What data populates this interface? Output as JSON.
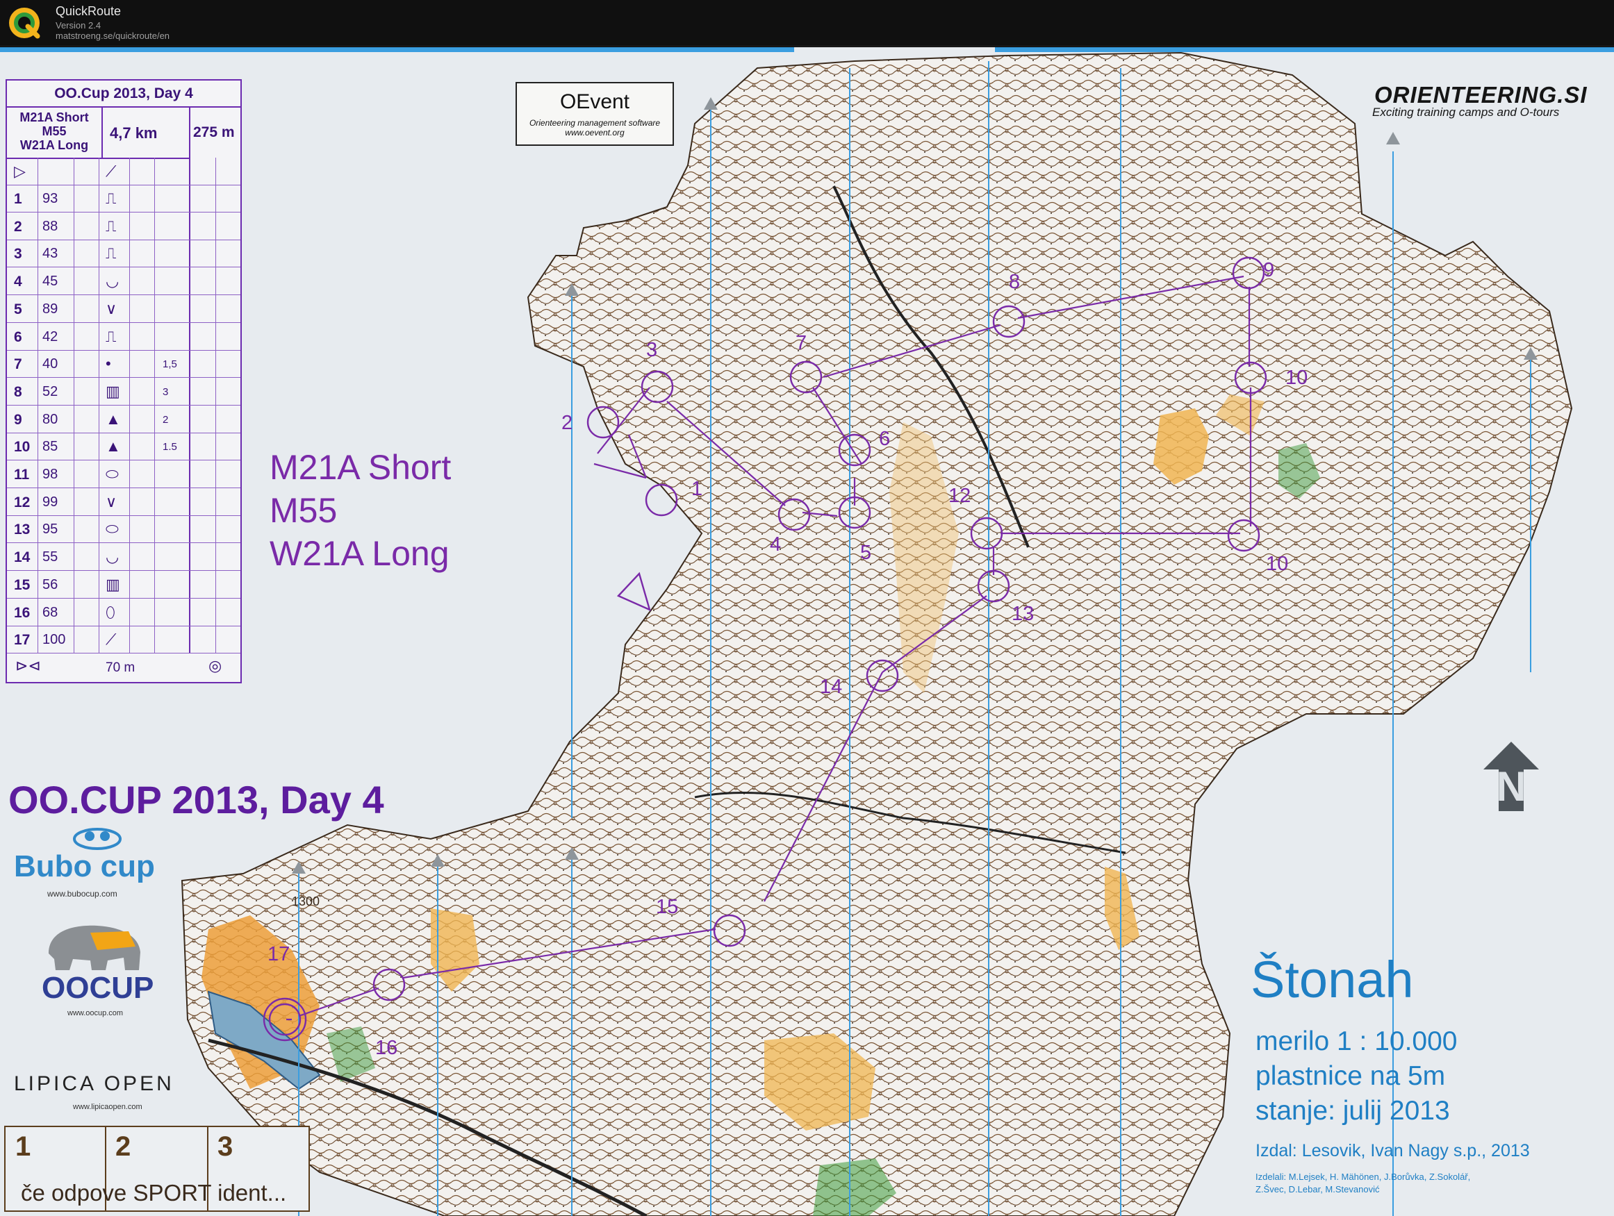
{
  "app": {
    "name": "QuickRoute",
    "version": "Version 2.4",
    "url": "matstroeng.se/quickroute/en",
    "logo_icon": "quickroute-q-icon"
  },
  "description_sheet": {
    "header": "OO.Cup 2013, Day 4",
    "class_line_1": "M21A Short",
    "class_line_2": "M55",
    "class_line_3": "W21A Long",
    "length": "4,7 km",
    "climb": "275 m",
    "rows": [
      {
        "num": "1",
        "code": "93"
      },
      {
        "num": "2",
        "code": "88"
      },
      {
        "num": "3",
        "code": "43"
      },
      {
        "num": "4",
        "code": "45"
      },
      {
        "num": "5",
        "code": "89"
      },
      {
        "num": "6",
        "code": "42"
      },
      {
        "num": "7",
        "code": "40",
        "dim": "1,5"
      },
      {
        "num": "8",
        "code": "52",
        "dim": "3"
      },
      {
        "num": "9",
        "code": "80",
        "dim": "2"
      },
      {
        "num": "10",
        "code": "85",
        "dim": "1.5"
      },
      {
        "num": "11",
        "code": "98"
      },
      {
        "num": "12",
        "code": "99"
      },
      {
        "num": "13",
        "code": "95"
      },
      {
        "num": "14",
        "code": "55"
      },
      {
        "num": "15",
        "code": "56"
      },
      {
        "num": "16",
        "code": "68"
      },
      {
        "num": "17",
        "code": "100"
      }
    ],
    "finish_distance": "70 m"
  },
  "classes_big": {
    "line1": "M21A Short",
    "line2": "M55",
    "line3": "W21A Long"
  },
  "event_title": "OO.CUP 2013, Day 4",
  "oevent": {
    "title": "OEvent",
    "subtitle": "Orienteering management software",
    "url": "www.oevent.org"
  },
  "orienteering_si": {
    "title": "ORIENTEERING.SI",
    "tagline": "Exciting training camps and O-tours"
  },
  "map_info": {
    "name": "Štonah",
    "scale": "merilo 1 : 10.000",
    "contours": "plastnice na 5m",
    "updated": "stanje: julij 2013",
    "publisher": "Izdal: Lesovik, Ivan Nagy s.p., 2013",
    "credits_1": "Izdelali: M.Lejsek, H. Mähönen, J.Borůvka, Z.Sokolář,",
    "credits_2": "Z.Švec, D.Lebar, M.Stevanović"
  },
  "sponsors": {
    "bubo": "Bubo cup",
    "bubo_url": "www.bubocup.com",
    "oocup": "OOCUP",
    "oocup_url": "www.oocup.com",
    "lipica": "LIPICA OPEN",
    "lipica_url": "www.lipicaopen.com"
  },
  "sport_ident": {
    "box1": "1",
    "box2": "2",
    "box3": "3",
    "note": "če odpove SPORT ident..."
  },
  "map_labels": {
    "height_1300": "1300"
  },
  "control_labels": [
    "1",
    "2",
    "3",
    "4",
    "5",
    "6",
    "7",
    "8",
    "9",
    "10",
    "10",
    "12",
    "13",
    "14",
    "15",
    "16",
    "17"
  ],
  "colors": {
    "course": "#7a2aa8",
    "map_blue": "#1f7fc4",
    "contour": "#6b4a2e",
    "open_land": "#f0b552",
    "forest_green": "#3d9a3d"
  }
}
